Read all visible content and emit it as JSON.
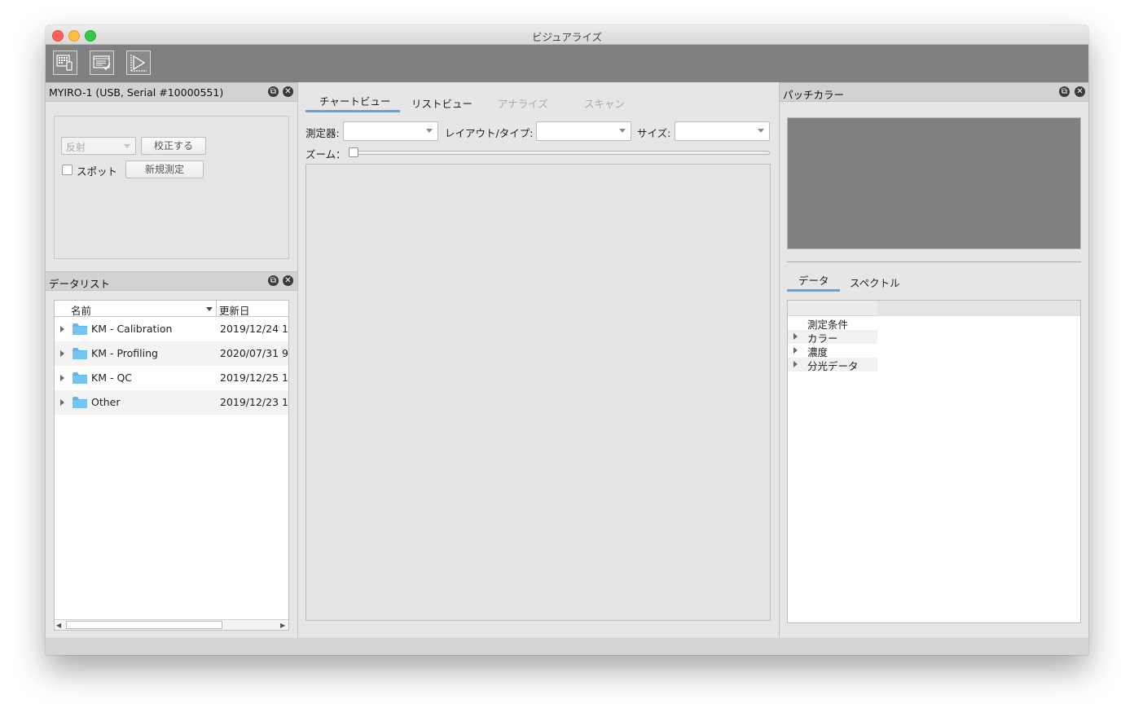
{
  "window": {
    "title": "ビジュアライズ"
  },
  "toolbar": {
    "buttons": [
      {
        "name": "measure-table-icon"
      },
      {
        "name": "list-check-icon"
      },
      {
        "name": "play-chart-icon"
      }
    ]
  },
  "device_panel": {
    "title": "MYIRO-1 (USB, Serial #10000551)",
    "mode_value": "反射",
    "calibrate_label": "校正する",
    "spot_label": "スポット",
    "new_measure_label": "新規測定"
  },
  "datalist_panel": {
    "title": "データリスト",
    "columns": [
      "名前",
      "更新日"
    ],
    "rows": [
      {
        "name": "KM - Calibration",
        "date": "2019/12/24 1"
      },
      {
        "name": "KM - Profiling",
        "date": "2020/07/31 9"
      },
      {
        "name": "KM - QC",
        "date": "2019/12/25 1"
      },
      {
        "name": "Other",
        "date": "2019/12/23 1"
      }
    ]
  },
  "center": {
    "tabs": [
      "チャートビュー",
      "リストビュー",
      "アナライズ",
      "スキャン"
    ],
    "active_tab": 0,
    "instrument_label": "測定器:",
    "layout_label": "レイアウト/タイプ:",
    "size_label": "サイズ:",
    "zoom_label": "ズーム："
  },
  "patch_panel": {
    "title": "パッチカラー",
    "swatch_color": "#808080",
    "tabs": [
      "データ",
      "スペクトル"
    ],
    "active_tab": 0,
    "tree_items": [
      {
        "label": "測定条件",
        "expandable": false
      },
      {
        "label": "カラー",
        "expandable": true
      },
      {
        "label": "濃度",
        "expandable": true
      },
      {
        "label": "分光データ",
        "expandable": true
      }
    ]
  },
  "colors": {
    "accent": "#5aa7e0",
    "toolbar": "#808080",
    "folder": "#5fb6e9"
  }
}
